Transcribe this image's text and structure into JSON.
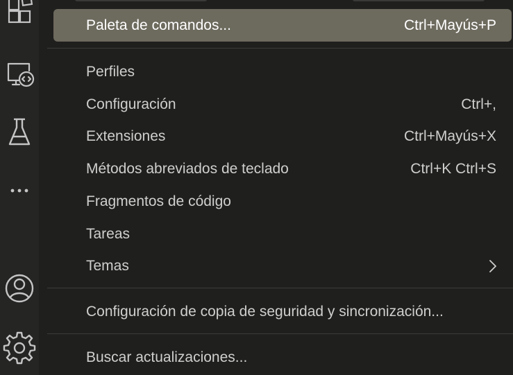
{
  "activity_bar": {
    "icons": [
      "extensions-icon",
      "remote-explorer-icon",
      "testing-flask-icon",
      "more-icon",
      "accounts-icon",
      "manage-gear-icon"
    ]
  },
  "menu": {
    "items": [
      {
        "label": "Paleta de comandos...",
        "shortcut": "Ctrl+Mayús+P"
      },
      {
        "label": "Perfiles",
        "shortcut": ""
      },
      {
        "label": "Configuración",
        "shortcut": "Ctrl+,"
      },
      {
        "label": "Extensiones",
        "shortcut": "Ctrl+Mayús+X"
      },
      {
        "label": "Métodos abreviados de teclado",
        "shortcut": "Ctrl+K Ctrl+S"
      },
      {
        "label": "Fragmentos de código",
        "shortcut": ""
      },
      {
        "label": "Tareas",
        "shortcut": ""
      },
      {
        "label": "Temas",
        "shortcut": ""
      },
      {
        "label": "Configuración de copia de seguridad y sincronización...",
        "shortcut": ""
      },
      {
        "label": "Buscar actualizaciones...",
        "shortcut": ""
      }
    ]
  },
  "colors": {
    "menu_background": "#1f1f1e",
    "selected_background": "#6d6a5e",
    "text": "#cfcfcd",
    "separator": "#3c3c3a"
  }
}
